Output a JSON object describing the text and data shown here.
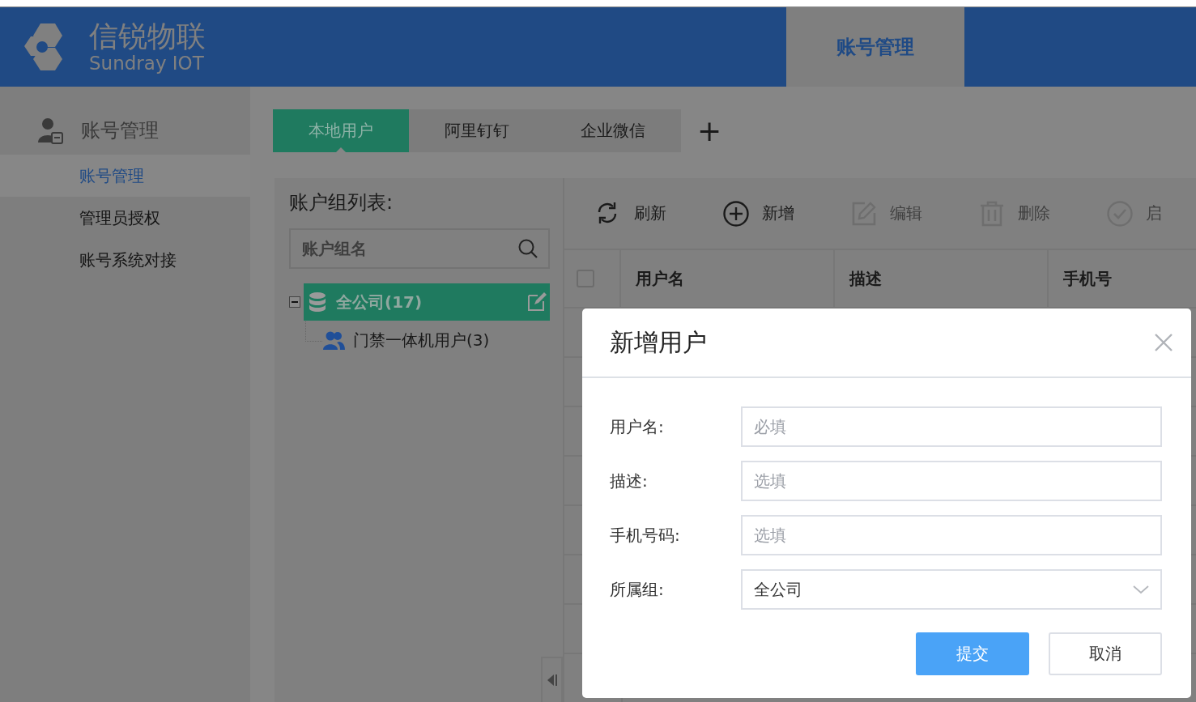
{
  "header": {
    "logo_title": "信锐物联",
    "logo_subtitle": "Sundray IOT",
    "nav": [
      {
        "label": "账号管理",
        "selected": true
      }
    ]
  },
  "sidebar": {
    "group": "账号管理",
    "items": [
      {
        "label": "账号管理",
        "selected": true
      },
      {
        "label": "管理员授权",
        "selected": false
      },
      {
        "label": "账号系统对接",
        "selected": false
      }
    ]
  },
  "tabs": [
    {
      "label": "本地用户",
      "selected": true
    },
    {
      "label": "阿里钉钉",
      "selected": false
    },
    {
      "label": "企业微信",
      "selected": false
    }
  ],
  "add_tab": "+",
  "group_panel": {
    "title": "账户组列表:",
    "search": {
      "placeholder": "账户组名"
    },
    "tree": [
      {
        "label": "全公司(17)",
        "selected": true,
        "expanded": true,
        "children": [
          {
            "label": "门禁一体机用户(3)",
            "selected": false
          }
        ]
      }
    ]
  },
  "toolbar": [
    {
      "kind": "refresh",
      "label": "刷新",
      "disabled": false
    },
    {
      "kind": "add",
      "label": "新增",
      "disabled": false
    },
    {
      "kind": "edit",
      "label": "编辑",
      "disabled": true
    },
    {
      "kind": "delete",
      "label": "删除",
      "disabled": true
    },
    {
      "kind": "enable",
      "label": "启",
      "disabled": true
    }
  ],
  "table": {
    "select_all_checked": false,
    "columns": [
      "用户名",
      "描述",
      "手机号"
    ]
  },
  "dialog": {
    "title": "新增用户",
    "fields": [
      {
        "kind": "text",
        "label": "用户名:",
        "placeholder": "必填"
      },
      {
        "kind": "text",
        "label": "描述:",
        "placeholder": "选填"
      },
      {
        "kind": "text",
        "label": "手机号码:",
        "placeholder": "选填"
      },
      {
        "kind": "select",
        "label": "所属组:",
        "value": "全公司"
      }
    ],
    "buttons": [
      {
        "kind": "primary",
        "label": "提交"
      },
      {
        "kind": "default",
        "label": "取消"
      }
    ]
  }
}
